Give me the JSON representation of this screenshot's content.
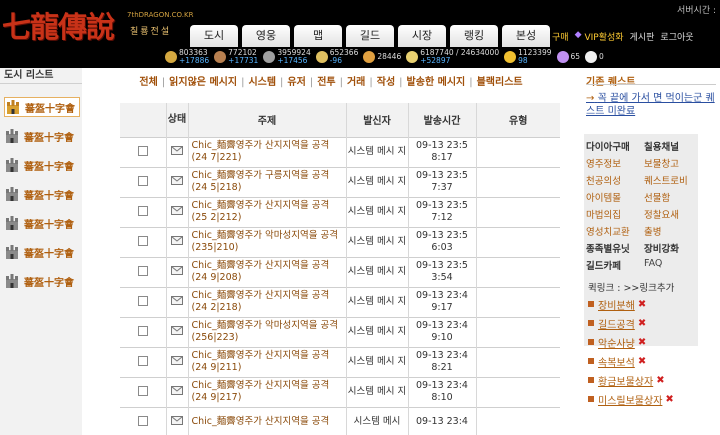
{
  "header": {
    "logo_text": "七龍傳說",
    "logo_site": "7thDRAGON.CO.KR",
    "logo_subtitle": "칠룡전설",
    "server_time_label": "서버시간 :"
  },
  "nav": {
    "tabs": [
      "도시",
      "영웅",
      "맵",
      "길드",
      "시장",
      "랭킹",
      "본성"
    ]
  },
  "top_links": {
    "purchase": "구매",
    "vip": "VIP활성화",
    "board": "게시판",
    "logout": "로그아웃"
  },
  "resources": [
    {
      "value": "803363",
      "delta": "+17886",
      "color": "#d4a840"
    },
    {
      "value": "772102",
      "delta": "+17731",
      "color": "#b88050"
    },
    {
      "value": "3959924",
      "delta": "+17456",
      "color": "#a0a0a0"
    },
    {
      "value": "652366",
      "delta": "-96",
      "color": "#e0c060"
    },
    {
      "value": "28446",
      "delta": "",
      "color": "#e0a040"
    },
    {
      "value": "6187740 / 24634000",
      "delta": "+52897",
      "color": "#e8d070"
    },
    {
      "value": "1123399",
      "delta": "98",
      "color": "#f0c030"
    },
    {
      "value": "65",
      "delta": "",
      "color": "#c090f0"
    },
    {
      "value": "0",
      "delta": "",
      "color": "#f0f0f0"
    }
  ],
  "sidebar": {
    "title": "도시 리스트",
    "cities": [
      {
        "name": "蕃盔十字會",
        "active": true
      },
      {
        "name": "蕃盔十字會",
        "active": false
      },
      {
        "name": "蕃盔十字會",
        "active": false
      },
      {
        "name": "蕃盔十字會",
        "active": false
      },
      {
        "name": "蕃盔十字會",
        "active": false
      },
      {
        "name": "蕃盔十字會",
        "active": false
      },
      {
        "name": "蕃盔十字會",
        "active": false
      }
    ]
  },
  "filters": [
    "전체",
    "읽지않은 메시지",
    "시스템",
    "유저",
    "전투",
    "거래",
    "작성",
    "발송한 메시지",
    "블랙리스트"
  ],
  "table": {
    "headers": [
      "",
      "상태",
      "주제",
      "발신자",
      "발송시간",
      "유형"
    ],
    "rows": [
      {
        "subject": "Chic_麵霽영주가 산지지역을 공격 (24 7|221)",
        "sender": "시스템 메시 지",
        "time": "09-13 23:5 8:17"
      },
      {
        "subject": "Chic_麵霽영주가 구릉지역을 공격 (24 5|218)",
        "sender": "시스템 메시 지",
        "time": "09-13 23:5 7:37"
      },
      {
        "subject": "Chic_麵霽영주가 산지지역을 공격 (25 2|212)",
        "sender": "시스템 메시 지",
        "time": "09-13 23:5 7:12"
      },
      {
        "subject": "Chic_麵霽영주가 악마성지역을 공격 (235|210)",
        "sender": "시스템 메시 지",
        "time": "09-13 23:5 6:03"
      },
      {
        "subject": "Chic_麵霽영주가 산지지역을 공격 (24 9|208)",
        "sender": "시스템 메시 지",
        "time": "09-13 23:5 3:54"
      },
      {
        "subject": "Chic_麵霽영주가 산지지역을 공격 (24 2|218)",
        "sender": "시스템 메시 지",
        "time": "09-13 23:4 9:17"
      },
      {
        "subject": "Chic_麵霽영주가 악마성지역을 공격 (256|223)",
        "sender": "시스템 메시 지",
        "time": "09-13 23:4 9:10"
      },
      {
        "subject": "Chic_麵霽영주가 산지지역을 공격 (24 9|211)",
        "sender": "시스템 메시 지",
        "time": "09-13 23:4 8:21"
      },
      {
        "subject": "Chic_麵霽영주가 산지지역을 공격 (24 9|217)",
        "sender": "시스템 메시 지",
        "time": "09-13 23:4 8:10"
      },
      {
        "subject": "Chic_麵霽영주가 산지지역을 공격",
        "sender": "시스템 메시",
        "time": "09-13 23:4"
      }
    ]
  },
  "right_panel": {
    "quest_title": "기존 퀘스트",
    "quest_link_prefix": "→",
    "quest_link": "꼭 끝에 가서 면 먹이는군 퀘스트 미완료",
    "menu_title": "다이아구매",
    "menu": {
      "channel": "칠용채널",
      "lord_info": "영주정보",
      "treasure": "보물창고",
      "friends": "천공의성",
      "quest_lobby": "퀘스트로비",
      "items": "아이템몰",
      "gift": "선물함",
      "magic_crystal": "마법의집",
      "fortune": "정찰요새",
      "hero_exchange": "영성치교환",
      "attendance": "출병",
      "class_unit": "종족별유닛",
      "equip_enhance": "장비강화",
      "guild_cafe": "길드카페",
      "faq": "FAQ"
    },
    "quicklinks_label": "퀵링크 : >>링크추가",
    "quicklinks": [
      "장비분해",
      "길드공격",
      "악순사냥",
      "속복보석",
      "황금보물상자",
      "미스릴보물상자"
    ]
  }
}
